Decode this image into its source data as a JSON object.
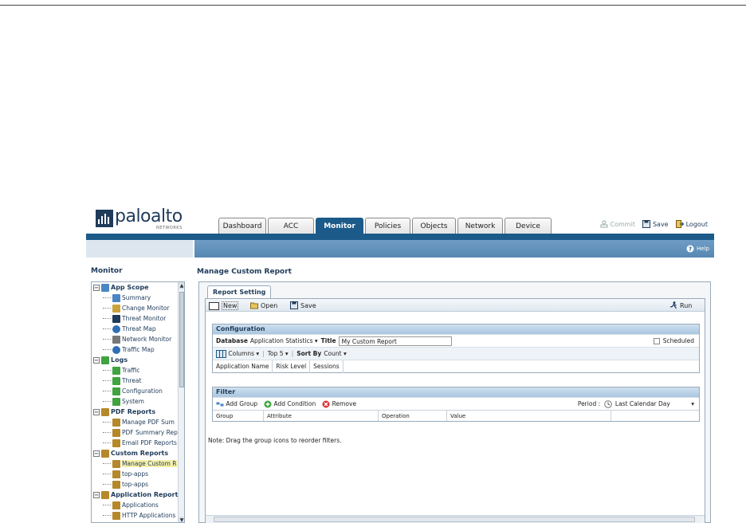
{
  "logo": {
    "name": "paloalto",
    "sub": "NETWORKS"
  },
  "tabs": [
    {
      "label": "Dashboard",
      "active": false
    },
    {
      "label": "ACC",
      "active": false
    },
    {
      "label": "Monitor",
      "active": true
    },
    {
      "label": "Policies",
      "active": false
    },
    {
      "label": "Objects",
      "active": false
    },
    {
      "label": "Network",
      "active": false
    },
    {
      "label": "Device",
      "active": false
    }
  ],
  "top_actions": {
    "commit": "Commit",
    "save": "Save",
    "logout": "Logout"
  },
  "help": "Help",
  "left": {
    "title": "Monitor",
    "tree": [
      {
        "type": "group",
        "label": "App Scope",
        "icon": "app-scope-icon"
      },
      {
        "type": "child",
        "label": "Summary",
        "icon": "summary-icon"
      },
      {
        "type": "child",
        "label": "Change Monitor",
        "icon": "change-monitor-icon"
      },
      {
        "type": "child",
        "label": "Threat Monitor",
        "icon": "threat-monitor-icon"
      },
      {
        "type": "child",
        "label": "Threat Map",
        "icon": "globe-icon"
      },
      {
        "type": "child",
        "label": "Network Monitor",
        "icon": "network-monitor-icon"
      },
      {
        "type": "child",
        "label": "Traffic Map",
        "icon": "globe-icon"
      },
      {
        "type": "group",
        "label": "Logs",
        "icon": "logs-icon"
      },
      {
        "type": "child",
        "label": "Traffic",
        "icon": "log-icon"
      },
      {
        "type": "child",
        "label": "Threat",
        "icon": "log-icon"
      },
      {
        "type": "child",
        "label": "Configuration",
        "icon": "log-icon"
      },
      {
        "type": "child",
        "label": "System",
        "icon": "log-icon"
      },
      {
        "type": "group",
        "label": "PDF Reports",
        "icon": "report-icon"
      },
      {
        "type": "child",
        "label": "Manage PDF Sum",
        "icon": "report-icon"
      },
      {
        "type": "child",
        "label": "PDF Summary Rep",
        "icon": "report-icon"
      },
      {
        "type": "child",
        "label": "Email PDF Reports",
        "icon": "report-icon"
      },
      {
        "type": "group",
        "label": "Custom Reports",
        "icon": "report-icon"
      },
      {
        "type": "child",
        "label": "Manage Custom R",
        "icon": "report-icon",
        "selected": true
      },
      {
        "type": "child",
        "label": "top-apps",
        "icon": "report-icon"
      },
      {
        "type": "child",
        "label": "top-apps",
        "icon": "report-icon"
      },
      {
        "type": "group",
        "label": "Application Report",
        "icon": "report-icon"
      },
      {
        "type": "child",
        "label": "Applications",
        "icon": "report-icon"
      },
      {
        "type": "child",
        "label": "HTTP Applications",
        "icon": "report-icon"
      }
    ]
  },
  "main": {
    "title": "Manage Custom Report",
    "tab": "Report Setting",
    "toolbar": {
      "new": "New",
      "open": "Open",
      "save": "Save",
      "run": "Run"
    },
    "configuration": {
      "heading": "Configuration",
      "database_label": "Database",
      "database_value": "Application Statistics",
      "title_label": "Title",
      "title_value": "My Custom Report",
      "scheduled_label": "Scheduled",
      "columns_label": "Columns",
      "top_label": "Top 5",
      "sortby_label": "Sort By",
      "sortby_value": "Count",
      "columns": [
        "Application Name",
        "Risk Level",
        "Sessions"
      ]
    },
    "filter": {
      "heading": "Filter",
      "add_group": "Add Group",
      "add_condition": "Add Condition",
      "remove": "Remove",
      "period_label": "Period :",
      "period_value": "Last Calendar Day",
      "columns": [
        "Group",
        "Attribute",
        "Operation",
        "Value"
      ]
    },
    "note": "Note: Drag the group icons to reorder filters."
  }
}
